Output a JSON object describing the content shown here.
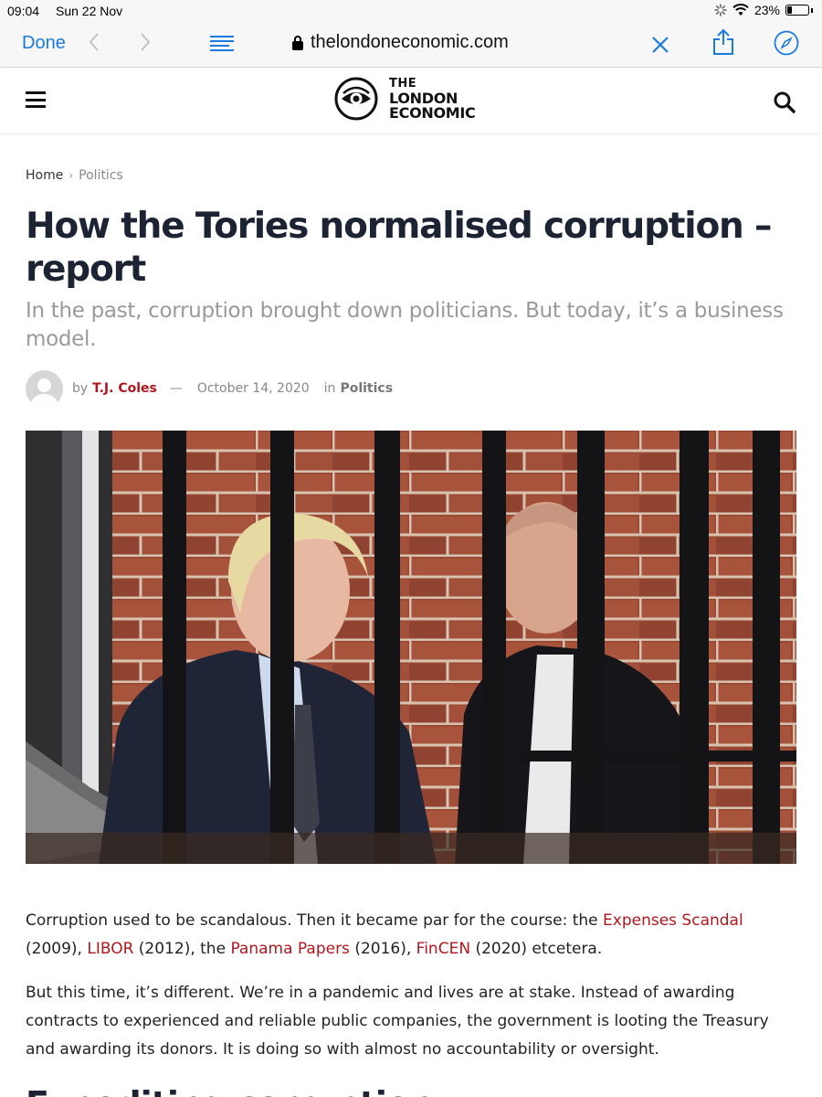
{
  "status_bar": {
    "time": "09:04",
    "date": "Sun 22 Nov",
    "battery": "23%",
    "battery_level": 0.23
  },
  "browser": {
    "done_label": "Done",
    "back_icon": "chevron-left-icon",
    "forward_icon": "chevron-right-icon",
    "url": "thelondoneconomic.com",
    "close_icon": "close-icon",
    "share_icon": "share-icon",
    "safari_icon": "compass-icon",
    "accent_color": "#1a7ae0"
  },
  "site": {
    "logo_line1": "THE",
    "logo_line2": "LONDON",
    "logo_line3": "ECONOMIC",
    "menu_icon": "hamburger-icon",
    "search_icon": "search-icon"
  },
  "breadcrumb": {
    "home": "Home",
    "separator": "›",
    "current": "Politics"
  },
  "article": {
    "title": "How the Tories normalised corruption – report",
    "subtitle": "In the past, corruption brought down politicians. But today, it’s a business model.",
    "meta": {
      "by": "by",
      "author": "T.J. Coles",
      "dash": "—",
      "date": "October 14, 2020",
      "in": "in",
      "category": "Politics"
    },
    "p1": {
      "t1": "Corruption used to be scandalous. Then it became par for the course: the ",
      "l1": "Expenses Scandal",
      "t2": " (2009), ",
      "l2": "LIBOR",
      "t3": " (2012), the ",
      "l3": "Panama Papers",
      "t4": " (2016), ",
      "l4": "FinCEN",
      "t5": " (2020) etcetera."
    },
    "p2": "But this time, it’s different. We’re in a pandemic and lives are at stake. Instead of awarding contracts to experienced and reliable public companies, the government is looting the Treasury and awarding its donors. It is doing so with almost no accountability or oversight.",
    "next_heading": "Expediting corruption"
  },
  "colors": {
    "link": "#b3171e",
    "title": "#1c2333",
    "subtitle": "#9a9a9a"
  }
}
